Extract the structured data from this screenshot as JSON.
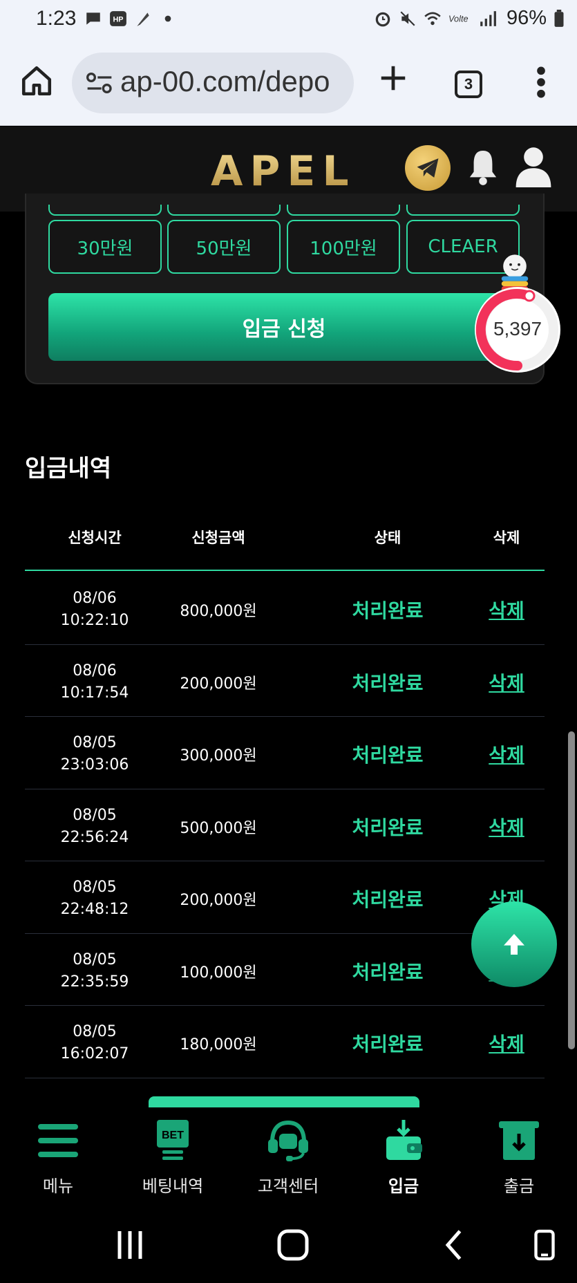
{
  "status_bar": {
    "time": "1:23",
    "battery": "96%",
    "left_icons": [
      "message-icon",
      "hp-icon",
      "feather-icon",
      "dot-icon"
    ],
    "right_icons": [
      "alarm-icon",
      "mute-icon",
      "wifi-icon",
      "volte-icon",
      "signal-icon",
      "battery-icon"
    ]
  },
  "browser": {
    "url": "ap-00.com/depo",
    "tab_count": "3"
  },
  "site": {
    "logo": "APEL"
  },
  "deposit": {
    "amount_buttons": [
      "30만원",
      "50만원",
      "100만원",
      "CLEAER"
    ],
    "submit_label": "입금 신청"
  },
  "counter": {
    "value": "5,397"
  },
  "history": {
    "title": "입금내역",
    "columns": [
      "신청시간",
      "신청금액",
      "상태",
      "삭제"
    ],
    "rows": [
      {
        "date": "08/06",
        "time": "10:22:10",
        "amount": "800,000원",
        "status": "처리완료",
        "delete": "삭제"
      },
      {
        "date": "08/06",
        "time": "10:17:54",
        "amount": "200,000원",
        "status": "처리완료",
        "delete": "삭제"
      },
      {
        "date": "08/05",
        "time": "23:03:06",
        "amount": "300,000원",
        "status": "처리완료",
        "delete": "삭제"
      },
      {
        "date": "08/05",
        "time": "22:56:24",
        "amount": "500,000원",
        "status": "처리완료",
        "delete": "삭제"
      },
      {
        "date": "08/05",
        "time": "22:48:12",
        "amount": "200,000원",
        "status": "처리완료",
        "delete": "삭제"
      },
      {
        "date": "08/05",
        "time": "22:35:59",
        "amount": "100,000원",
        "status": "처리완료",
        "delete": "삭제"
      },
      {
        "date": "08/05",
        "time": "16:02:07",
        "amount": "180,000원",
        "status": "처리완료",
        "delete": "삭제"
      }
    ]
  },
  "bottom_nav": [
    {
      "label": "메뉴",
      "icon": "menu-icon",
      "active": false
    },
    {
      "label": "베팅내역",
      "icon": "bet-icon",
      "active": false
    },
    {
      "label": "고객센터",
      "icon": "headset-icon",
      "active": false
    },
    {
      "label": "입금",
      "icon": "wallet-icon",
      "active": true
    },
    {
      "label": "출금",
      "icon": "withdraw-icon",
      "active": false
    }
  ],
  "colors": {
    "accent": "#2fd9a0",
    "gold": "#d8b560",
    "background": "#000000"
  }
}
